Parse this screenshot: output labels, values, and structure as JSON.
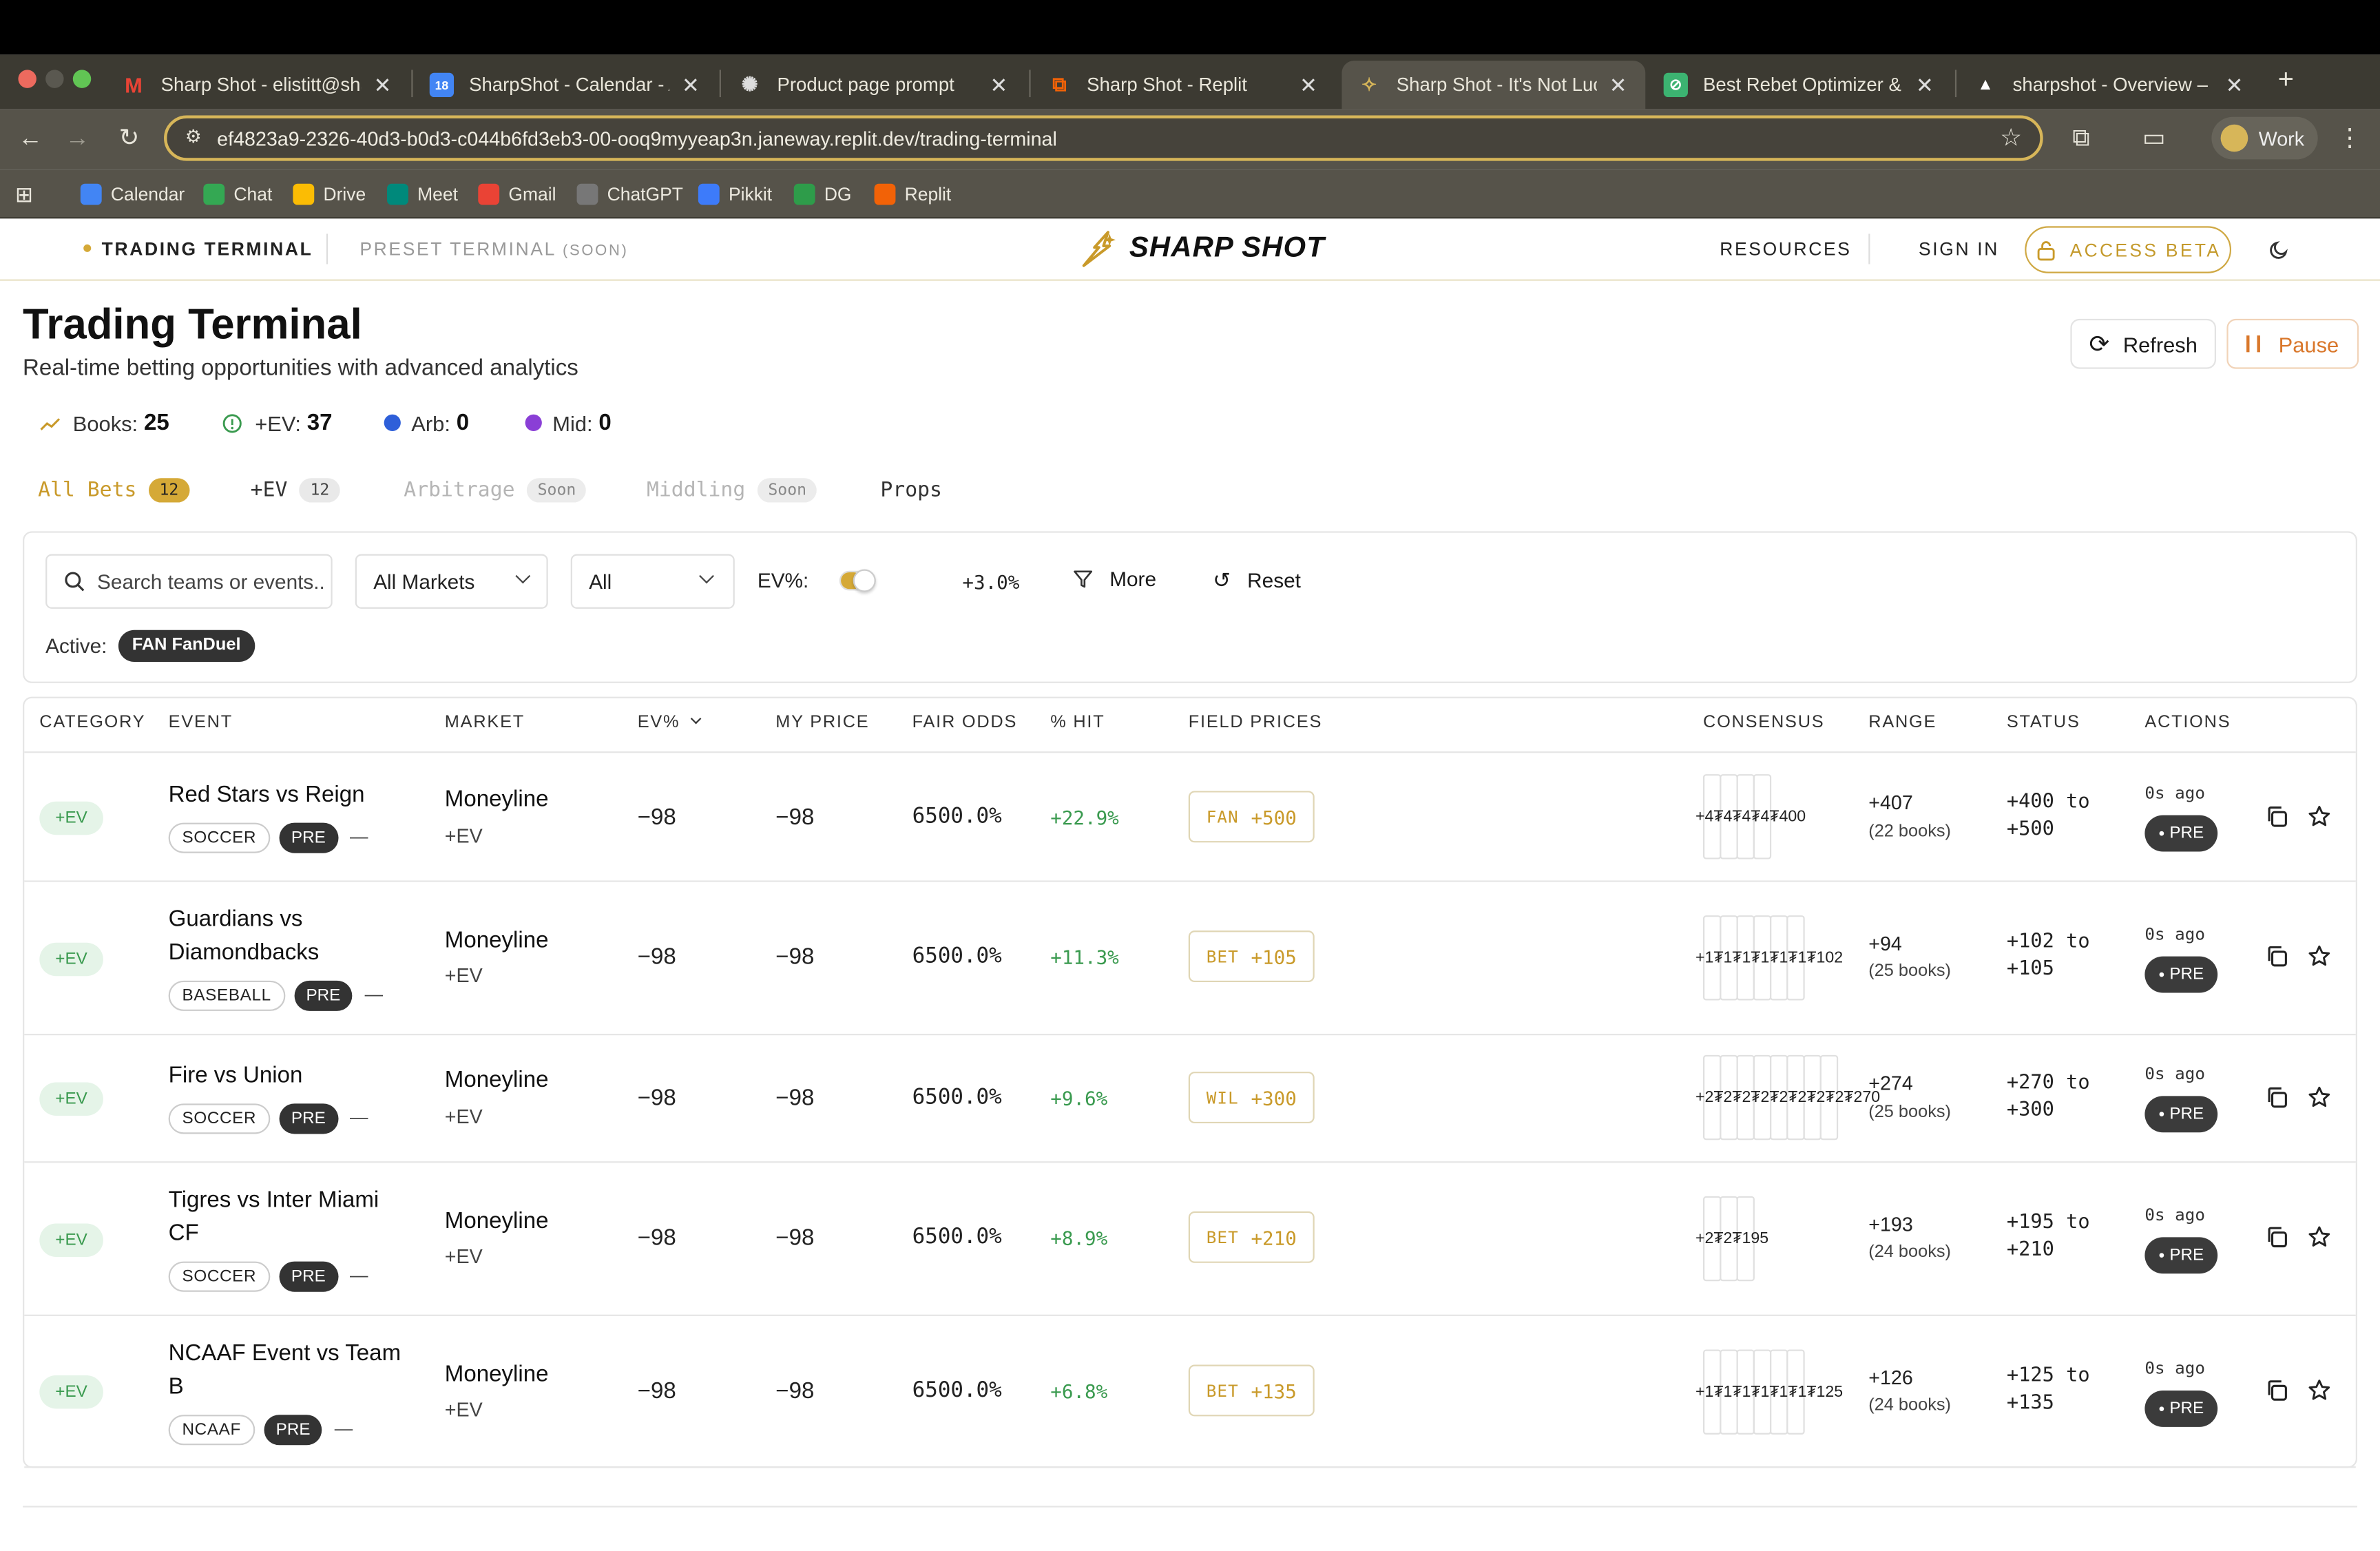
{
  "browser": {
    "tabs": [
      {
        "title": "Sharp Shot - elistitt@sharp",
        "icon": "gmail-icon"
      },
      {
        "title": "SharpShot - Calendar - Au",
        "icon": "calendar-icon"
      },
      {
        "title": "Product page prompt",
        "icon": "chatgpt-icon"
      },
      {
        "title": "Sharp Shot - Replit",
        "icon": "replit-icon"
      },
      {
        "title": "Sharp Shot - It's Not Luck",
        "icon": "sharpshot-icon"
      },
      {
        "title": "Best Rebet Optimizer & Too",
        "icon": "link-icon"
      },
      {
        "title": "sharpshot - Overview – Ver",
        "icon": "vercel-icon"
      }
    ],
    "url": "ef4823a9-2326-40d3-b0d3-c044b6fd3eb3-00-ooq9myyeap3n.janeway.replit.dev/trading-terminal",
    "profile": "Work",
    "bookmarks": [
      "Calendar",
      "Chat",
      "Drive",
      "Meet",
      "Gmail",
      "ChatGPT",
      "Pikkit",
      "DG",
      "Replit"
    ]
  },
  "site": {
    "nav_left": [
      "TRADING TERMINAL",
      "PRESET TERMINAL"
    ],
    "soon_tag": "(SOON)",
    "brand": "SHARP SHOT",
    "nav_right": [
      "RESOURCES",
      "SIGN IN"
    ],
    "access_beta": "ACCESS BETA"
  },
  "page": {
    "title": "Trading Terminal",
    "subtitle": "Real-time betting opportunities with advanced analytics",
    "refresh": "Refresh",
    "pause": "Pause",
    "stats": [
      {
        "label": "Books:",
        "value": "25"
      },
      {
        "label": "+EV:",
        "value": "37"
      },
      {
        "label": "Arb:",
        "value": "0"
      },
      {
        "label": "Mid:",
        "value": "0"
      }
    ],
    "tabs": [
      {
        "label": "All Bets",
        "count": "12"
      },
      {
        "label": "+EV",
        "count": "12"
      },
      {
        "label": "Arbitrage",
        "count": "Soon"
      },
      {
        "label": "Middling",
        "count": "Soon"
      },
      {
        "label": "Props",
        "count": ""
      }
    ],
    "filters": {
      "search_placeholder": "Search teams or events...",
      "market": "All Markets",
      "type": "All",
      "ev_label": "EV%:",
      "ev_value": "+3.0%",
      "more": "More",
      "reset": "Reset",
      "active_label": "Active:",
      "active_chip": "FAN FanDuel"
    },
    "columns": [
      "CATEGORY",
      "EVENT",
      "MARKET",
      "EV%",
      "MY PRICE",
      "FAIR ODDS",
      "% HIT",
      "FIELD PRICES",
      "CONSENSUS",
      "RANGE",
      "STATUS",
      "ACTIONS"
    ],
    "rows": [
      {
        "category": "+EV",
        "event": "Red Stars vs Reign",
        "sport": "SOCCER",
        "pre": "PRE",
        "dash": "—",
        "market": "Moneyline",
        "market_sub": "+EV",
        "ev": "−98",
        "my_price": "−98",
        "fair_odds": "6500.0%",
        "hit": "+22.9%",
        "field_book": "FAN",
        "field_price": "+500",
        "consensus": "+4₮4₮4₮4₮400",
        "range": "+407",
        "range_books": "(22 books)",
        "status_line1": "+400 to",
        "status_line2": "+500",
        "ago": "0s ago",
        "status_badge": "PRE"
      },
      {
        "category": "+EV",
        "event_line1": "Guardians vs",
        "event_line2": "Diamondbacks",
        "sport": "BASEBALL",
        "pre": "PRE",
        "dash": "—",
        "market": "Moneyline",
        "market_sub": "+EV",
        "ev": "−98",
        "my_price": "−98",
        "fair_odds": "6500.0%",
        "hit": "+11.3%",
        "field_book": "BET",
        "field_price": "+105",
        "consensus": "+1₮1₮1₮1₮1₮1₮102",
        "range": "+94",
        "range_books": "(25 books)",
        "status_line1": "+102 to",
        "status_line2": "+105",
        "ago": "0s ago",
        "status_badge": "PRE"
      },
      {
        "category": "+EV",
        "event": "Fire vs Union",
        "sport": "SOCCER",
        "pre": "PRE",
        "dash": "—",
        "market": "Moneyline",
        "market_sub": "+EV",
        "ev": "−98",
        "my_price": "−98",
        "fair_odds": "6500.0%",
        "hit": "+9.6%",
        "field_book": "WIL",
        "field_price": "+300",
        "consensus": "+2₮2₮2₮2₮2₮2₮2₮2₮270",
        "range": "+274",
        "range_books": "(25 books)",
        "status_line1": "+270 to",
        "status_line2": "+300",
        "ago": "0s ago",
        "status_badge": "PRE"
      },
      {
        "category": "+EV",
        "event_line1": "Tigres vs Inter Miami",
        "event_line2": "CF",
        "sport": "SOCCER",
        "pre": "PRE",
        "dash": "—",
        "market": "Moneyline",
        "market_sub": "+EV",
        "ev": "−98",
        "my_price": "−98",
        "fair_odds": "6500.0%",
        "hit": "+8.9%",
        "field_book": "BET",
        "field_price": "+210",
        "consensus": "+2₮2₮195",
        "range": "+193",
        "range_books": "(24 books)",
        "status_line1": "+195 to",
        "status_line2": "+210",
        "ago": "0s ago",
        "status_badge": "PRE"
      },
      {
        "category": "+EV",
        "event_line1": "NCAAF Event vs Team",
        "event_line2": "B",
        "sport": "NCAAF",
        "pre": "PRE",
        "dash": "—",
        "market": "Moneyline",
        "market_sub": "+EV",
        "ev": "−98",
        "my_price": "−98",
        "fair_odds": "6500.0%",
        "hit": "+6.8%",
        "field_book": "BET",
        "field_price": "+135",
        "consensus": "+1₮1₮1₮1₮1₮1₮125",
        "range": "+126",
        "range_books": "(24 books)",
        "status_line1": "+125 to",
        "status_line2": "+135",
        "ago": "0s ago",
        "status_badge": "PRE"
      }
    ]
  },
  "colors": {
    "accent": "#c99a2a",
    "ev_green": "#3a9a4f",
    "pause_orange": "#d9772b"
  }
}
